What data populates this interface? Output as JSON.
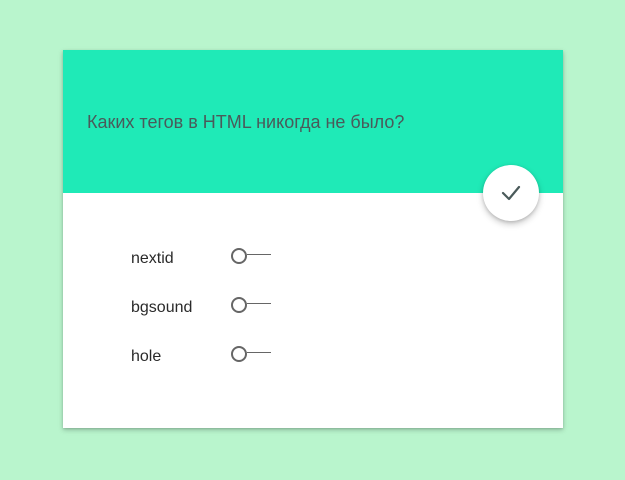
{
  "quiz": {
    "question": "Каких тегов в HTML никогда не было?",
    "submit_icon": "check-icon",
    "options": [
      {
        "label": "nextid",
        "selected": false
      },
      {
        "label": "bgsound",
        "selected": false
      },
      {
        "label": "hole",
        "selected": false
      }
    ]
  },
  "colors": {
    "background": "#b9f5cd",
    "header": "#1feab7",
    "card": "#ffffff",
    "question_text": "#4a5a5a",
    "radio": "#666666"
  }
}
